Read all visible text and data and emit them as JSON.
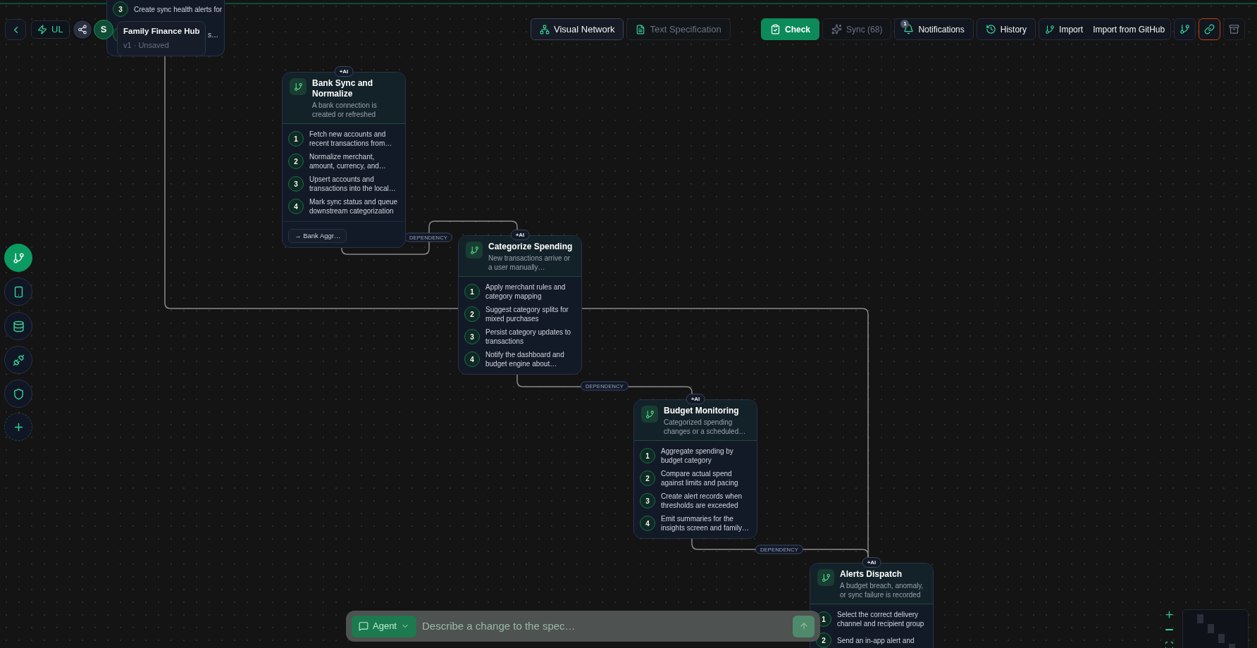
{
  "toolbar": {
    "mode": "UL",
    "avatar": "S",
    "project": {
      "name": "Family Finance Hub",
      "meta": "v1 · Unsaved"
    }
  },
  "view_tabs": [
    {
      "label": "Visual Network",
      "kind": "network",
      "selected": true
    },
    {
      "label": "Text Specification",
      "kind": "document",
      "selected": false
    }
  ],
  "actions": [
    {
      "kind": "check",
      "label": "Check"
    },
    {
      "kind": "sync",
      "label": "Sync (68)",
      "disabled": true
    },
    {
      "kind": "notifications",
      "label": "Notifications",
      "badge": "1"
    },
    {
      "kind": "history",
      "label": "History"
    },
    {
      "kind": "import",
      "label": "Import",
      "extra": "Import from GitHub"
    },
    {
      "kind": "branch"
    },
    {
      "kind": "link",
      "highlighted": true
    },
    {
      "kind": "archive"
    }
  ],
  "sidebar": [
    {
      "kind": "flows",
      "selected": true
    },
    {
      "kind": "screens",
      "selected": false
    },
    {
      "kind": "data",
      "selected": false
    },
    {
      "kind": "integrations",
      "selected": false
    },
    {
      "kind": "security",
      "selected": false
    },
    {
      "kind": "add",
      "selected": false
    }
  ],
  "nodes": [
    {
      "kind": "partial",
      "steps": [
        {
          "number": "3",
          "text": "Create sync health alerts for"
        },
        {
          "text": "s…"
        }
      ]
    },
    {
      "kind": "card",
      "badge": "+AI",
      "title": "Bank Sync and Normalize",
      "trigger": "A bank connection is created or refreshed",
      "steps": [
        {
          "number": "1",
          "text": "Fetch new accounts and recent transactions from…"
        },
        {
          "number": "2",
          "text": "Normalize merchant, amount, currency, and…"
        },
        {
          "number": "3",
          "text": "Upsert accounts and transactions into the local…"
        },
        {
          "number": "4",
          "text": "Mark sync status and queue downstream categorization"
        }
      ],
      "link": "→ Bank Aggr…"
    },
    {
      "kind": "card",
      "badge": "+AI",
      "title": "Categorize Spending",
      "trigger": "New transactions arrive or a user manually…",
      "steps": [
        {
          "number": "1",
          "text": "Apply merchant rules and category mapping"
        },
        {
          "number": "2",
          "text": "Suggest category splits for mixed purchases"
        },
        {
          "number": "3",
          "text": "Persist category updates to transactions"
        },
        {
          "number": "4",
          "text": "Notify the dashboard and budget engine about…"
        }
      ]
    },
    {
      "kind": "card",
      "badge": "+AI",
      "title": "Budget Monitoring",
      "trigger": "Categorized spending changes or a scheduled…",
      "steps": [
        {
          "number": "1",
          "text": "Aggregate spending by budget category"
        },
        {
          "number": "2",
          "text": "Compare actual spend against limits and pacing"
        },
        {
          "number": "3",
          "text": "Create alert records when thresholds are exceeded"
        },
        {
          "number": "4",
          "text": "Emit summaries for the insights screen and family…"
        }
      ]
    },
    {
      "kind": "card",
      "badge": "+AI",
      "title": "Alerts Dispatch",
      "trigger": "A budget breach, anomaly, or sync failure is recorded",
      "steps": [
        {
          "number": "1",
          "text": "Select the correct delivery channel and recipient group"
        },
        {
          "number": "2",
          "text": "Send an in-app alert and"
        }
      ]
    }
  ],
  "edges": [
    {
      "kind": "plain"
    },
    {
      "kind": "dependency",
      "label": "DEPENDENCY"
    },
    {
      "kind": "dependency",
      "label": "DEPENDENCY"
    },
    {
      "kind": "dependency",
      "label": "DEPENDENCY"
    }
  ],
  "chat": {
    "mode": "Agent",
    "placeholder": "Describe a change to the spec…"
  }
}
